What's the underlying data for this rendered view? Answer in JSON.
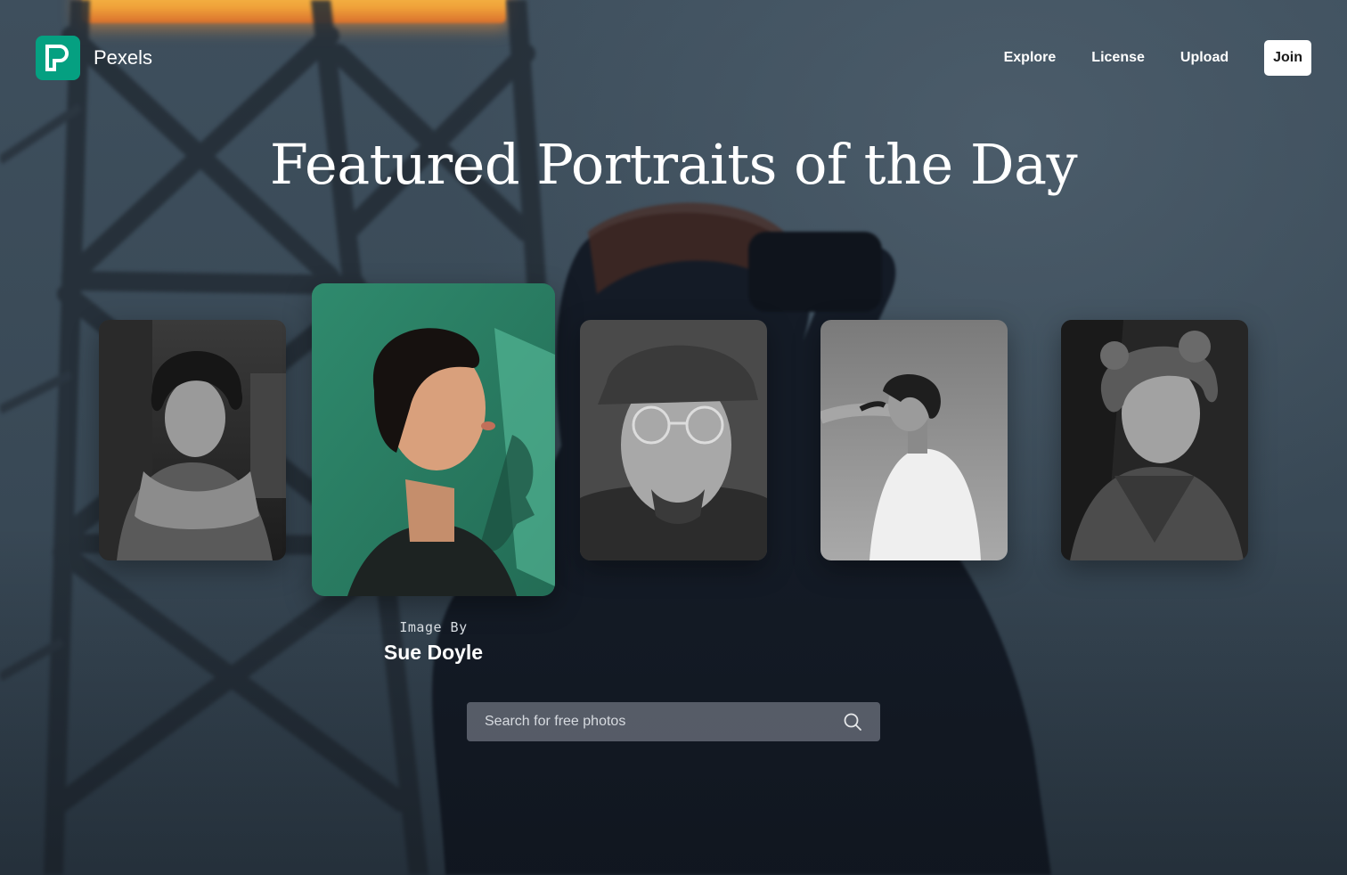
{
  "header": {
    "brand": "Pexels",
    "nav": [
      "Explore",
      "License",
      "Upload"
    ],
    "join_label": "Join"
  },
  "hero": {
    "title": "Featured Portraits of the Day"
  },
  "portraits": [
    {
      "tone": "bw",
      "subject": "curly-haired young man with scarf"
    },
    {
      "tone": "color",
      "subject": "short-haired woman on green background",
      "featured": true
    },
    {
      "tone": "bw",
      "subject": "man with glasses and beanie"
    },
    {
      "tone": "bw",
      "subject": "woman in white t-shirt against sky"
    },
    {
      "tone": "bw",
      "subject": "curly-haired young man in jacket"
    }
  ],
  "credit": {
    "label": "Image By",
    "name": "Sue Doyle"
  },
  "search": {
    "placeholder": "Search for free photos",
    "icon": "search-icon"
  },
  "colors": {
    "brand": "#05a081",
    "background": "#3a4a58",
    "featured_bg": "#2f8a6d"
  }
}
